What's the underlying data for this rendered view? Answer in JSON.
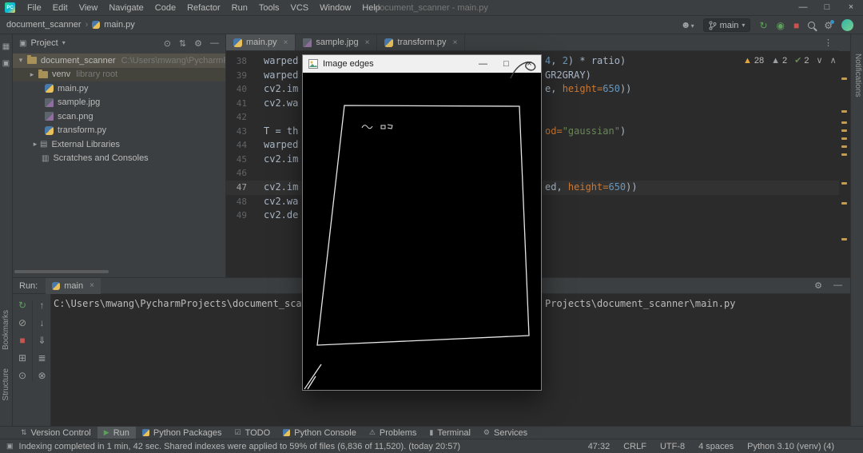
{
  "titlebar": {
    "logo": "PC",
    "menus": [
      "File",
      "Edit",
      "View",
      "Navigate",
      "Code",
      "Refactor",
      "Run",
      "Tools",
      "VCS",
      "Window",
      "Help"
    ],
    "title": "document_scanner - main.py"
  },
  "navbar": {
    "breadcrumb_project": "document_scanner",
    "breadcrumb_file": "main.py",
    "branch": "main"
  },
  "project": {
    "header": "Project",
    "tree": [
      {
        "label": "document_scanner",
        "detail": "C:\\Users\\mwang\\PycharmProjects"
      },
      {
        "label": "venv",
        "detail": "library root"
      },
      {
        "label": "main.py"
      },
      {
        "label": "sample.jpg"
      },
      {
        "label": "scan.png"
      },
      {
        "label": "transform.py"
      },
      {
        "label": "External Libraries"
      },
      {
        "label": "Scratches and Consoles"
      }
    ]
  },
  "editor": {
    "tabs": [
      {
        "label": "main.py"
      },
      {
        "label": "sample.jpg"
      },
      {
        "label": "transform.py"
      }
    ],
    "inspections": {
      "warnings": "28",
      "weak": "2",
      "ok": "2"
    },
    "lines": [
      {
        "num": "38",
        "left": "warped",
        "right": [
          {
            "t": "4",
            "c": "num"
          },
          {
            "t": ", ",
            "c": "plain"
          },
          {
            "t": "2",
            "c": "num"
          },
          {
            "t": ") * ratio)",
            "c": "plain"
          }
        ]
      },
      {
        "num": "39",
        "left": "warped",
        "right": [
          {
            "t": "GR2GRAY)",
            "c": "plain"
          }
        ]
      },
      {
        "num": "40",
        "left": "cv2.im",
        "right": [
          {
            "t": "e, ",
            "c": "plain"
          },
          {
            "t": "height=",
            "c": "kw"
          },
          {
            "t": "650",
            "c": "num"
          },
          {
            "t": "))",
            "c": "plain"
          }
        ]
      },
      {
        "num": "41",
        "left": "cv2.wa",
        "right": []
      },
      {
        "num": "42",
        "left": "",
        "right": []
      },
      {
        "num": "43",
        "left": "T = th",
        "right": [
          {
            "t": "od=",
            "c": "kw"
          },
          {
            "t": "\"gaussian\"",
            "c": "str"
          },
          {
            "t": ")",
            "c": "plain"
          }
        ]
      },
      {
        "num": "44",
        "left": "warped",
        "right": []
      },
      {
        "num": "45",
        "left": "cv2.im",
        "right": []
      },
      {
        "num": "46",
        "left": "",
        "right": []
      },
      {
        "num": "47",
        "left": "cv2.im",
        "right": [
          {
            "t": "ed, ",
            "c": "plain"
          },
          {
            "t": "height=",
            "c": "kw"
          },
          {
            "t": "650",
            "c": "num"
          },
          {
            "t": "))",
            "c": "plain"
          }
        ]
      },
      {
        "num": "48",
        "left": "cv2.wa",
        "right": []
      },
      {
        "num": "49",
        "left": "cv2.de",
        "right": []
      }
    ]
  },
  "image_window": {
    "title": "Image edges"
  },
  "run": {
    "label": "Run:",
    "tab": "main",
    "console_left": "C:\\Users\\mwang\\PycharmProjects\\document_scanner\\",
    "console_right": "Projects\\document_scanner\\main.py"
  },
  "bottom_tabs": [
    "Version Control",
    "Run",
    "Python Packages",
    "TODO",
    "Python Console",
    "Problems",
    "Terminal",
    "Services"
  ],
  "statusbar": {
    "message": "Indexing completed in 1 min, 42 sec. Shared indexes were applied to 59% of files (6,836 of 11,520). (today 20:57)",
    "caret": "47:32",
    "line_sep": "CRLF",
    "encoding": "UTF-8",
    "indent": "4 spaces",
    "interpreter": "Python 3.10 (venv) (4)"
  },
  "stripes": {
    "left": [
      "Bookmarks",
      "Structure"
    ],
    "right": [
      "Notifications"
    ]
  }
}
